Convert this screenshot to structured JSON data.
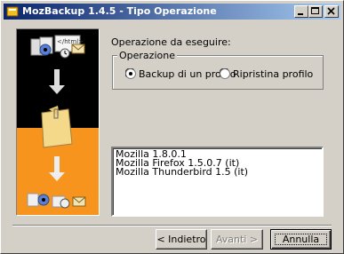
{
  "window": {
    "title": "MozBackup 1.4.5 - Tipo Operazione"
  },
  "main": {
    "operation_label": "Operazione da eseguire:",
    "group_title": "Operazione",
    "options": [
      {
        "label": "Backup di un profilo",
        "selected": true
      },
      {
        "label": "Ripristina profilo",
        "selected": false
      }
    ],
    "profiles": [
      "Mozilla 1.8.0.1",
      "Mozilla Firefox 1.5.0.7 (it)",
      "Mozilla Thunderbird 1.5 (it)"
    ]
  },
  "buttons": {
    "back": "< Indietro",
    "next": "Avanti >",
    "cancel": "Annulla"
  },
  "banner": {
    "html_tag": "</html>"
  },
  "colors": {
    "banner_top": "#000000",
    "banner_bottom": "#f7941d",
    "titlebar": "#0a246a"
  }
}
